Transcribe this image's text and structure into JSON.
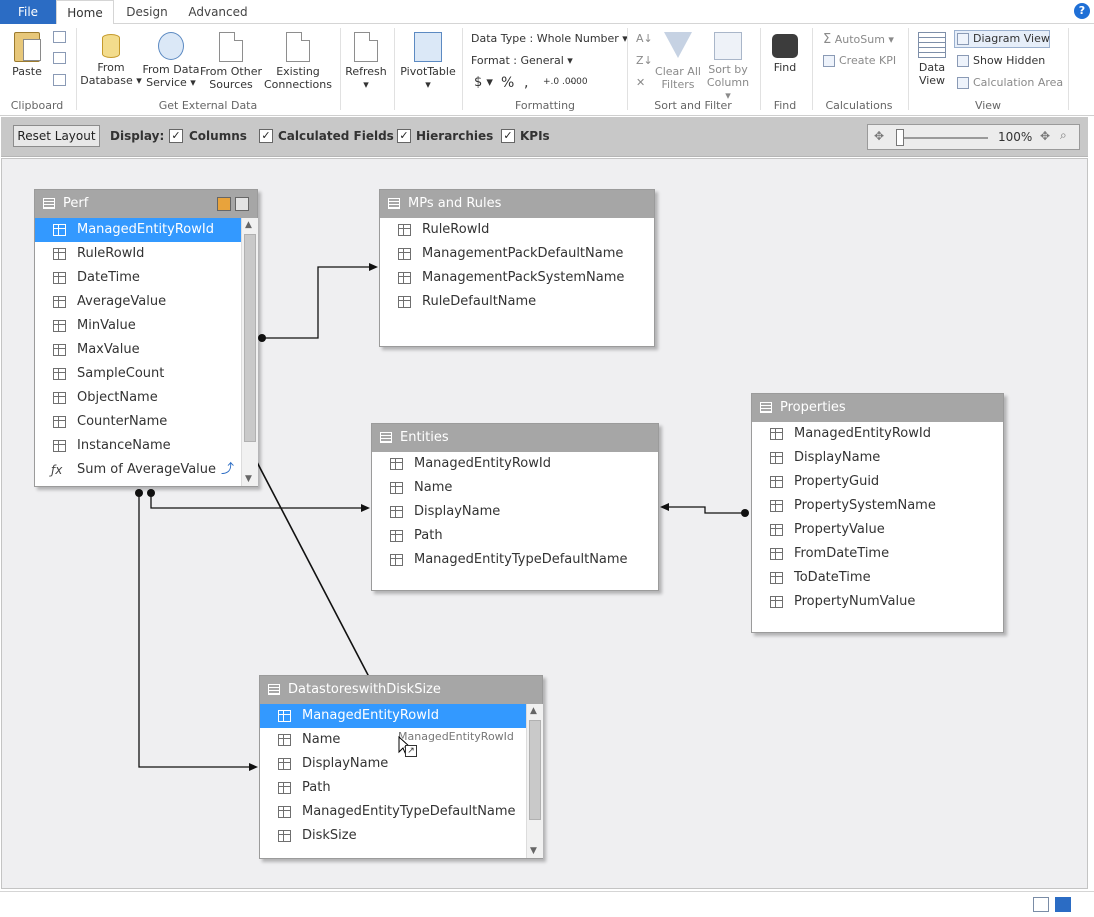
{
  "ribbon": {
    "tabs": [
      "File",
      "Home",
      "Design",
      "Advanced"
    ],
    "clipboard": {
      "paste": "Paste",
      "group": "Clipboard"
    },
    "external": {
      "from_database": "From Database",
      "from_data_service": "From Data Service",
      "from_other_sources": "From Other Sources",
      "existing_connections": "Existing Connections",
      "group": "Get External Data"
    },
    "refresh": "Refresh",
    "pivottable": "PivotTable",
    "formatting": {
      "data_type": "Data Type : Whole Number",
      "format": "Format : General",
      "currency": "$",
      "percent": "%",
      "comma": ",",
      "inc_dec": "+.0 .00",
      "dec_dec": "-.00",
      "group": "Formatting"
    },
    "sortfilter": {
      "clear_all_filters": "Clear All Filters",
      "sort_by_column": "Sort by Column",
      "group": "Sort and Filter"
    },
    "find": {
      "label": "Find",
      "group": "Find"
    },
    "calculations": {
      "autosum": "AutoSum",
      "create_kpi": "Create KPI",
      "group": "Calculations"
    },
    "view": {
      "data_view": "Data View",
      "diagram_view": "Diagram View",
      "show_hidden": "Show Hidden",
      "calculation_area": "Calculation Area",
      "group": "View"
    }
  },
  "toolbar": {
    "reset_layout": "Reset Layout",
    "display": "Display:",
    "checks": [
      "Columns",
      "Calculated Fields",
      "Hierarchies",
      "KPIs"
    ],
    "zoom": "100%"
  },
  "tables": {
    "perf": {
      "name": "Perf",
      "rows": [
        "ManagedEntityRowId",
        "RuleRowId",
        "DateTime",
        "AverageValue",
        "MinValue",
        "MaxValue",
        "SampleCount",
        "ObjectName",
        "CounterName",
        "InstanceName"
      ],
      "measure": "Sum of AverageValue"
    },
    "mps": {
      "name": "MPs and Rules",
      "rows": [
        "RuleRowId",
        "ManagementPackDefaultName",
        "ManagementPackSystemName",
        "RuleDefaultName"
      ]
    },
    "entities": {
      "name": "Entities",
      "rows": [
        "ManagedEntityRowId",
        "Name",
        "DisplayName",
        "Path",
        "ManagedEntityTypeDefaultName"
      ]
    },
    "properties": {
      "name": "Properties",
      "rows": [
        "ManagedEntityRowId",
        "DisplayName",
        "PropertyGuid",
        "PropertySystemName",
        "PropertyValue",
        "FromDateTime",
        "ToDateTime",
        "PropertyNumValue"
      ]
    },
    "datastores": {
      "name": "DatastoreswithDiskSize",
      "rows": [
        "ManagedEntityRowId",
        "Name",
        "DisplayName",
        "Path",
        "ManagedEntityTypeDefaultName",
        "DiskSize"
      ]
    }
  },
  "drag": {
    "label": "ManagedEntityRowId"
  },
  "help": "?"
}
